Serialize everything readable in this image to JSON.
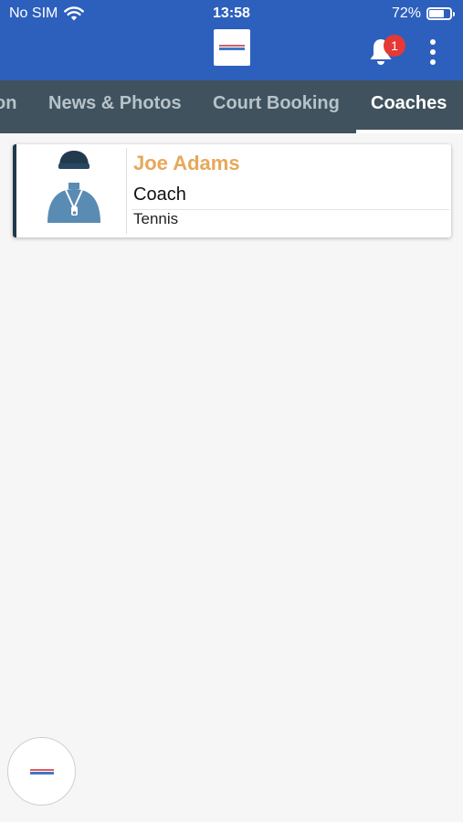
{
  "status_bar": {
    "carrier": "No SIM",
    "time": "13:58",
    "battery_percent": "72%",
    "battery_level": 0.72,
    "icons": [
      "wifi-icon",
      "battery-icon"
    ]
  },
  "app_bar": {
    "logo_icon": "club-logo",
    "notification_count": "1",
    "icons": [
      "bell-icon",
      "more-vertical-icon"
    ]
  },
  "tabs": [
    {
      "label": "on",
      "active": false
    },
    {
      "label": "News & Photos",
      "active": false
    },
    {
      "label": "Court Booking",
      "active": false
    },
    {
      "label": "Coaches",
      "active": true
    }
  ],
  "coaches": [
    {
      "name": "Joe Adams",
      "role": "Coach",
      "sport": "Tennis",
      "avatar_icon": "coach-avatar-icon"
    }
  ],
  "fab": {
    "icon": "club-logo"
  },
  "colors": {
    "header": "#2d5fbd",
    "tabbar": "#40525d",
    "accent_name": "#e7a85a",
    "badge": "#e53935",
    "card_border": "#1f3a4b",
    "background": "#f6f6f6"
  }
}
